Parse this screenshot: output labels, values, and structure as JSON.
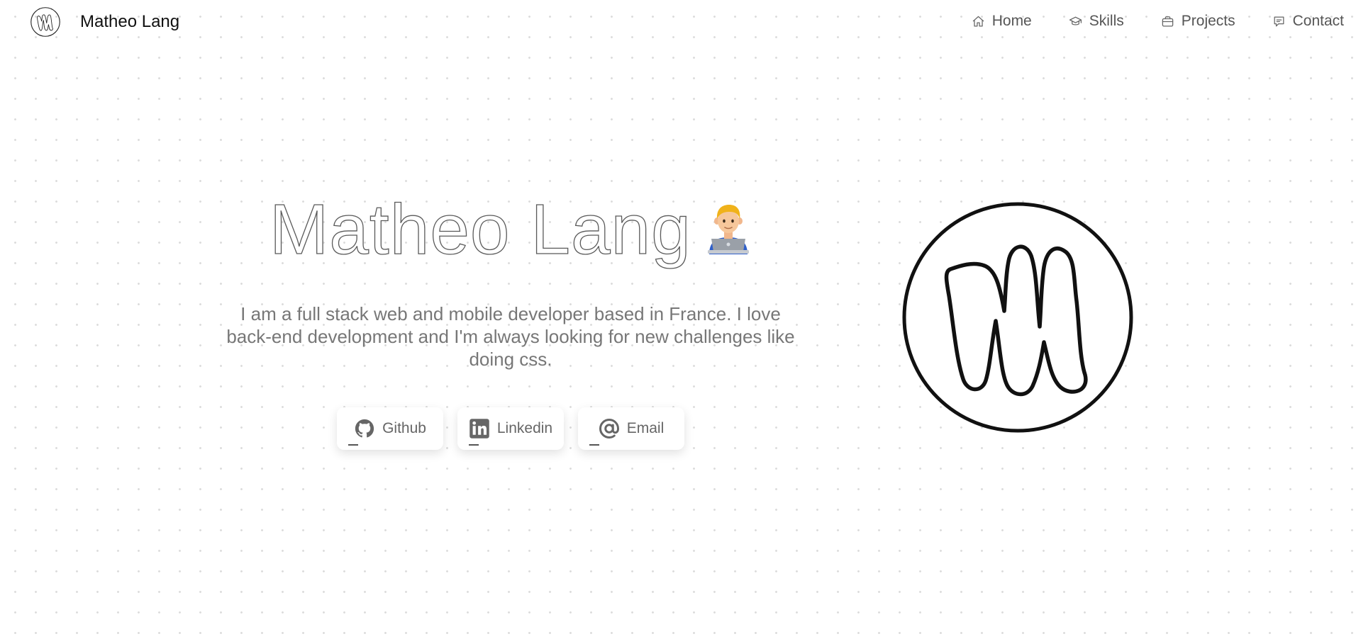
{
  "brand": {
    "name": "Matheo Lang",
    "logo_icon": "m-monogram-icon"
  },
  "nav": {
    "items": [
      {
        "label": "Home",
        "icon": "home-icon"
      },
      {
        "label": "Skills",
        "icon": "graduation-cap-icon"
      },
      {
        "label": "Projects",
        "icon": "briefcase-icon"
      },
      {
        "label": "Contact",
        "icon": "chat-icon"
      }
    ]
  },
  "hero": {
    "title": "Matheo Lang",
    "emoji_icon": "man-technologist-icon",
    "description": "I am a full stack web and mobile developer based in France. I love back-end development and I'm always looking for new challenges like doing css."
  },
  "social": [
    {
      "label": "Github",
      "icon": "github-icon"
    },
    {
      "label": "Linkedin",
      "icon": "linkedin-icon"
    },
    {
      "label": "Email",
      "icon": "at-sign-icon"
    }
  ],
  "colors": {
    "background": "#ffffff",
    "dots": "#dcdcdc",
    "text_muted": "#777777",
    "outline": "#111111"
  }
}
